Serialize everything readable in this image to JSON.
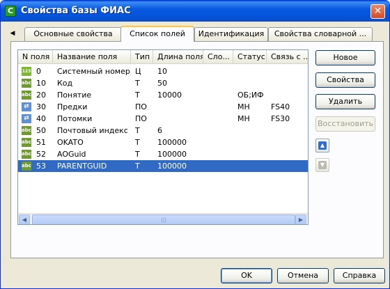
{
  "window": {
    "title": "Свойства базы ФИАС",
    "app_icon_letter": "C"
  },
  "tabs": [
    {
      "label": "Основные свойства",
      "active": false
    },
    {
      "label": "Список полей",
      "active": true
    },
    {
      "label": "Идентификация",
      "active": false
    },
    {
      "label": "Свойства словарной ...",
      "active": false
    }
  ],
  "tab_scroll_left": "◀",
  "table": {
    "headers": [
      "N поля",
      "Название поля",
      "Тип",
      "Длина поля",
      "Сло...",
      "Статус",
      "Связь с ..."
    ],
    "rows": [
      {
        "icon": "number-type-icon",
        "icon_text": "123",
        "num": "0",
        "name": "Системный номер",
        "type": "Ц",
        "length": "10",
        "slo": "",
        "status": "",
        "link": "",
        "selected": false
      },
      {
        "icon": "text-type-icon",
        "icon_text": "abc",
        "num": "10",
        "name": "Код",
        "type": "Т",
        "length": "50",
        "slo": "",
        "status": "",
        "link": "",
        "selected": false
      },
      {
        "icon": "text-type-icon",
        "icon_text": "abc",
        "num": "20",
        "name": "Понятие",
        "type": "Т",
        "length": "10000",
        "slo": "",
        "status": "ОБ;ИФ",
        "link": "",
        "selected": false
      },
      {
        "icon": "link-type-icon",
        "icon_text": "⇄",
        "num": "30",
        "name": "Предки",
        "type": "ПО",
        "length": "",
        "slo": "",
        "status": "МН",
        "link": "FS40",
        "selected": false
      },
      {
        "icon": "link-type-icon",
        "icon_text": "⇄",
        "num": "40",
        "name": "Потомки",
        "type": "ПО",
        "length": "",
        "slo": "",
        "status": "МН",
        "link": "FS30",
        "selected": false
      },
      {
        "icon": "text-type-icon",
        "icon_text": "abc",
        "num": "50",
        "name": "Почтовый индекс",
        "type": "Т",
        "length": "6",
        "slo": "",
        "status": "",
        "link": "",
        "selected": false
      },
      {
        "icon": "text-type-icon",
        "icon_text": "abc",
        "num": "51",
        "name": "OKATO",
        "type": "Т",
        "length": "100000",
        "slo": "",
        "status": "",
        "link": "",
        "selected": false
      },
      {
        "icon": "text-type-icon",
        "icon_text": "abc",
        "num": "52",
        "name": "AOGuid",
        "type": "Т",
        "length": "100000",
        "slo": "",
        "status": "",
        "link": "",
        "selected": false
      },
      {
        "icon": "text-type-icon",
        "icon_text": "abc",
        "num": "53",
        "name": "PARENTGUID",
        "type": "Т",
        "length": "100000",
        "slo": "",
        "status": "",
        "link": "",
        "selected": true
      }
    ]
  },
  "scrollbar": {
    "left": "◀",
    "right": "▶",
    "grip": "|||"
  },
  "side_buttons": {
    "new": "Новое",
    "properties": "Свойства",
    "delete": "Удалить",
    "restore": "Восстановить"
  },
  "move_up_glyph": "▲",
  "move_down_glyph": "▼",
  "footer": {
    "ok": "OK",
    "cancel": "Отмена",
    "help": "Справка"
  },
  "colors": {
    "titlebar": "#0858e0",
    "selection": "#316ac5",
    "active_tab_accent": "#ffc83c",
    "close_button": "#d5492a"
  }
}
